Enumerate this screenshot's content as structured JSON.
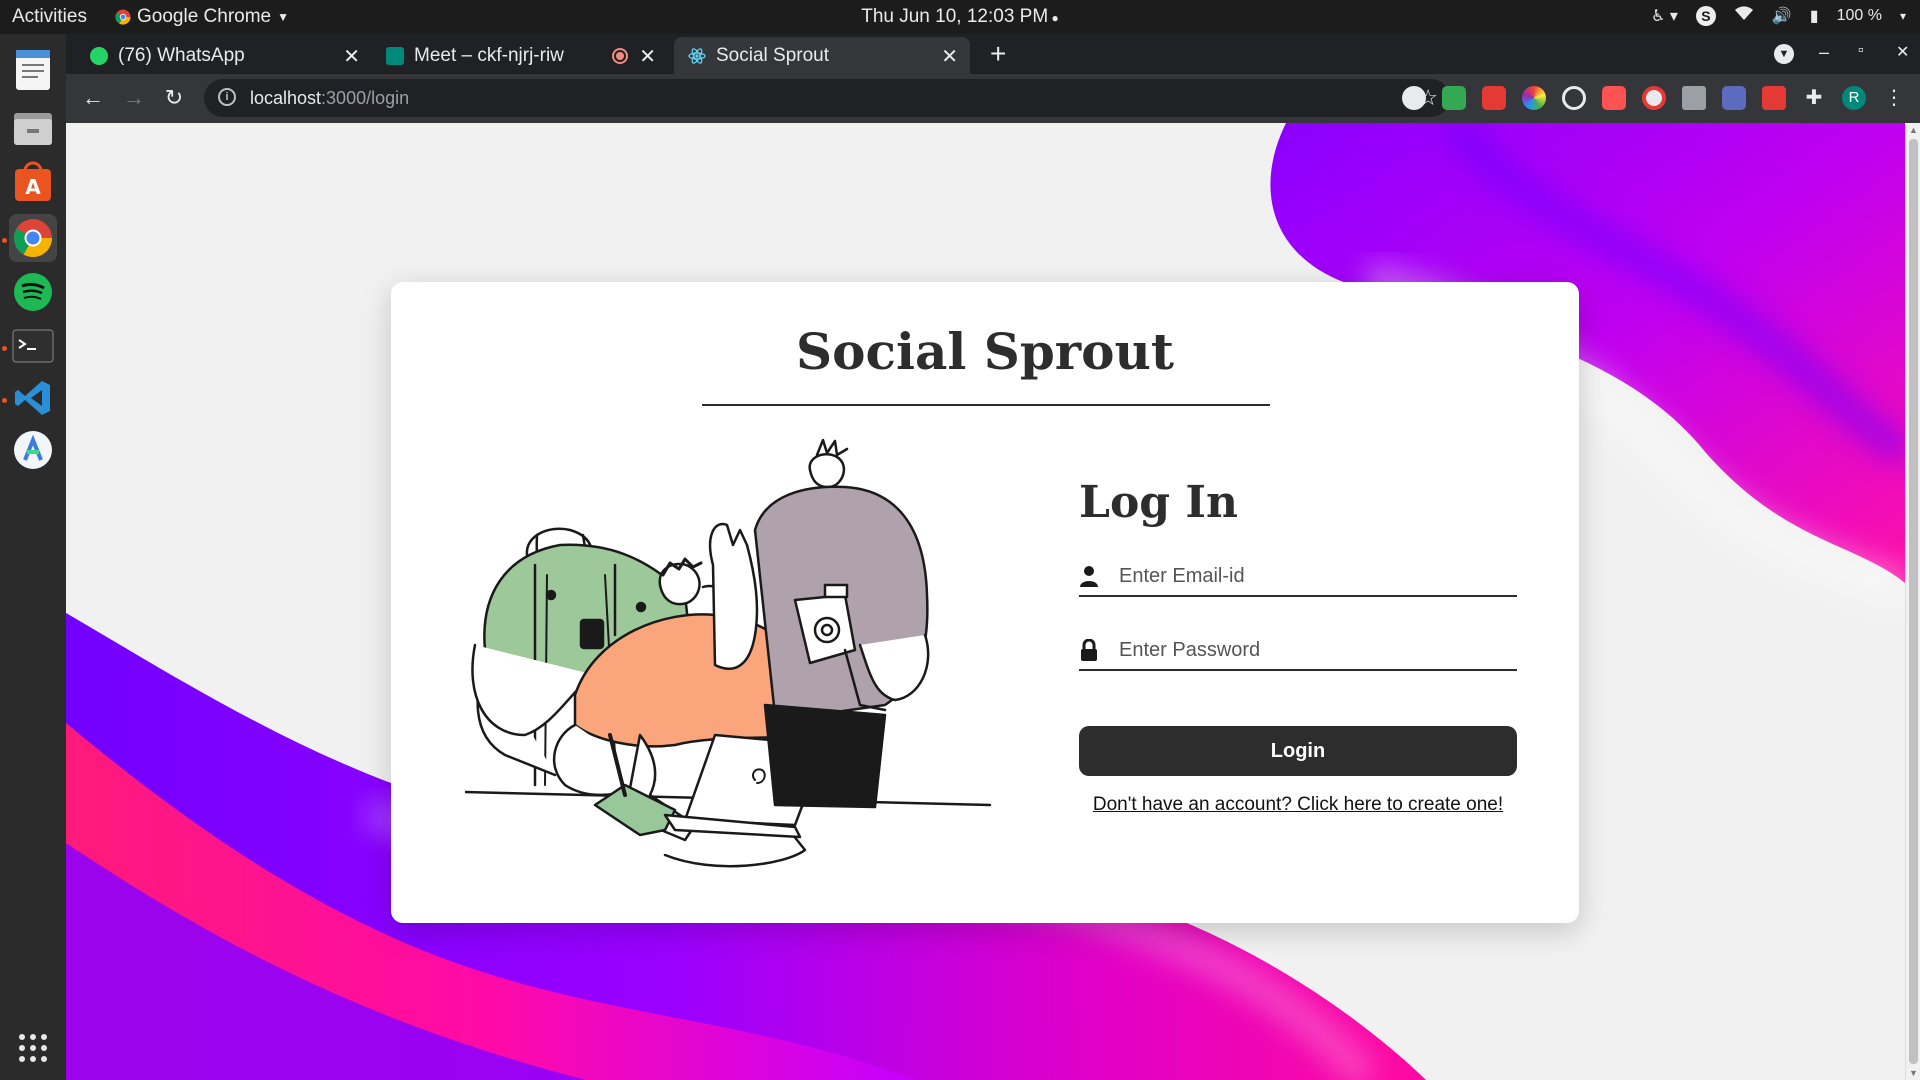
{
  "system_bar": {
    "activities": "Activities",
    "app_name": "Google Chrome",
    "clock": "Thu Jun 10, 12:03 PM",
    "battery": "100 %"
  },
  "dock": {
    "items": [
      "text-editor",
      "files",
      "software-center",
      "chrome",
      "spotify",
      "terminal",
      "vscode",
      "android-studio",
      "app-grid"
    ]
  },
  "browser": {
    "tabs": [
      {
        "title": "(76) WhatsApp",
        "active": false
      },
      {
        "title": "Meet – ckf-njrj-riw",
        "active": false,
        "recording": true
      },
      {
        "title": "Social Sprout",
        "active": true
      }
    ],
    "url_host": "localhost",
    "url_path": ":3000/login",
    "profile_initial": "R"
  },
  "page": {
    "brand": "Social Sprout",
    "heading": "Log In",
    "email_placeholder": "Enter Email-id",
    "password_placeholder": "Enter Password",
    "login_label": "Login",
    "signup_link": "Don't have an account? Click here to create one!"
  },
  "colors": {
    "brand_dark": "#2d2d2d",
    "gradient_purple": "#7b00ff",
    "gradient_magenta": "#ff10a8"
  }
}
